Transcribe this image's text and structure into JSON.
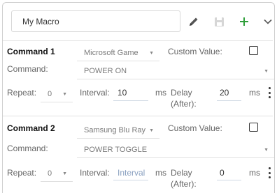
{
  "macro": {
    "name": "My Macro"
  },
  "toolbar": {
    "edit_icon": "pencil-icon",
    "save_icon": "floppy-disk-icon",
    "add_icon": "plus-icon",
    "expand_icon": "chevron-down-icon",
    "add_color": "#2e9e3a"
  },
  "labels": {
    "command": "Command:",
    "custom_value": "Custom Value:",
    "repeat": "Repeat:",
    "interval": "Interval:",
    "ms": "ms",
    "delay": "Delay",
    "after": "(After):"
  },
  "commands": [
    {
      "title": "Command 1",
      "device": "Microsoft Game",
      "command": "POWER ON",
      "repeat": "0",
      "interval": "10",
      "delay": "20"
    },
    {
      "title": "Command 2",
      "device": "Samsung Blu Ray",
      "command": "POWER TOGGLE",
      "repeat": "0",
      "interval_placeholder": "Interval",
      "delay": "0"
    }
  ]
}
